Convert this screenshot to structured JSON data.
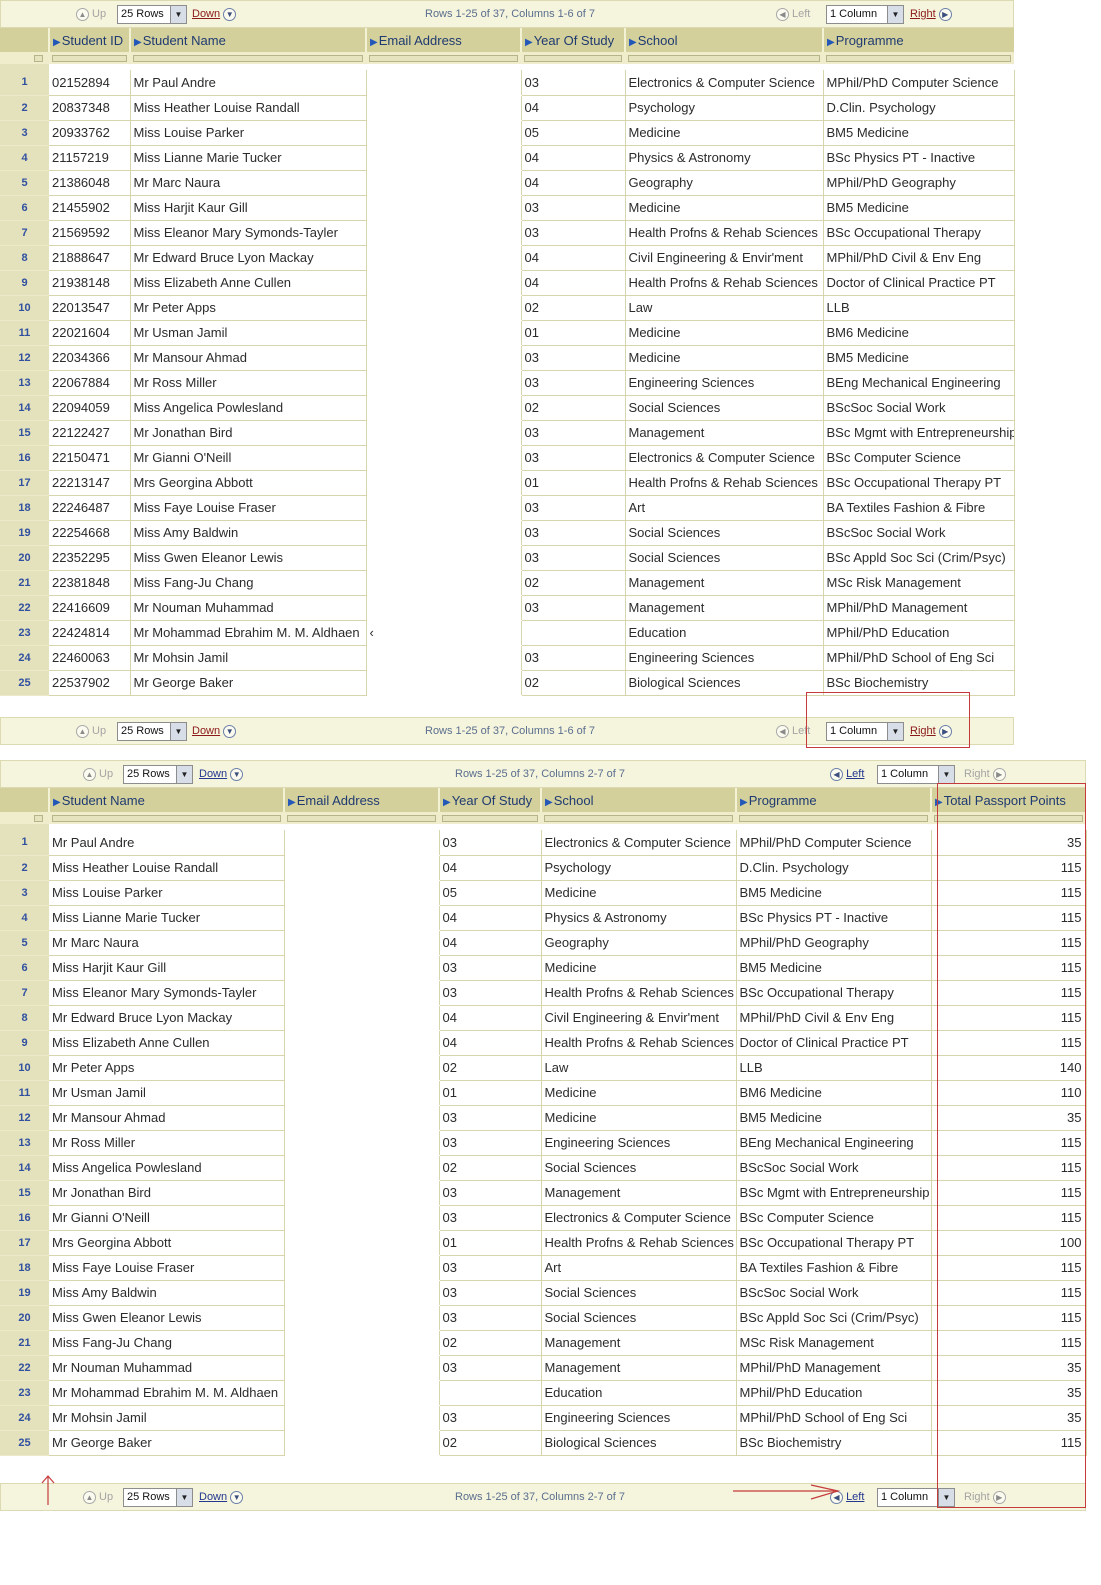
{
  "top": {
    "nav_top": {
      "up": "Up",
      "rows": "25 Rows",
      "down": "Down",
      "status": "Rows 1-25 of 37, Columns 1-6 of 7",
      "left": "Left",
      "cols": "1 Column",
      "right": "Right"
    },
    "nav_bottom": {
      "up": "Up",
      "rows": "25 Rows",
      "down": "Down",
      "status": "Rows 1-25 of 37, Columns 1-6 of 7",
      "left": "Left",
      "cols": "1 Column",
      "right": "Right"
    },
    "headers": [
      "Student ID",
      "Student Name",
      "Email Address",
      "Year Of Study",
      "School",
      "Programme"
    ],
    "rows": [
      {
        "n": "1",
        "id": "02152894",
        "name": "Mr Paul  Andre",
        "email": "",
        "year": "03",
        "school": "Electronics & Computer Science",
        "prog": "MPhil/PhD Computer Science"
      },
      {
        "n": "2",
        "id": "20837348",
        "name": "Miss Heather Louise Randall",
        "email": "",
        "year": "04",
        "school": "Psychology",
        "prog": "D.Clin. Psychology"
      },
      {
        "n": "3",
        "id": "20933762",
        "name": "Miss Louise  Parker",
        "email": "",
        "year": "05",
        "school": "Medicine",
        "prog": "BM5 Medicine"
      },
      {
        "n": "4",
        "id": "21157219",
        "name": "Miss Lianne Marie Tucker",
        "email": "",
        "year": "04",
        "school": "Physics & Astronomy",
        "prog": "BSc Physics PT - Inactive"
      },
      {
        "n": "5",
        "id": "21386048",
        "name": "Mr Marc  Naura",
        "email": "",
        "year": "04",
        "school": "Geography",
        "prog": "MPhil/PhD Geography"
      },
      {
        "n": "6",
        "id": "21455902",
        "name": "Miss Harjit Kaur Gill",
        "email": "",
        "year": "03",
        "school": "Medicine",
        "prog": "BM5 Medicine"
      },
      {
        "n": "7",
        "id": "21569592",
        "name": "Miss Eleanor Mary Symonds-Tayler",
        "email": "",
        "year": "03",
        "school": "Health Profns & Rehab Sciences",
        "prog": "BSc Occupational Therapy"
      },
      {
        "n": "8",
        "id": "21888647",
        "name": "Mr Edward Bruce Lyon Mackay",
        "email": "",
        "year": "04",
        "school": "Civil Engineering & Envir'ment",
        "prog": "MPhil/PhD Civil & Env Eng"
      },
      {
        "n": "9",
        "id": "21938148",
        "name": "Miss Elizabeth Anne Cullen",
        "email": "",
        "year": "04",
        "school": "Health Profns & Rehab Sciences",
        "prog": "Doctor of Clinical Practice PT"
      },
      {
        "n": "10",
        "id": "22013547",
        "name": "Mr Peter  Apps",
        "email": "",
        "year": "02",
        "school": "Law",
        "prog": "LLB"
      },
      {
        "n": "11",
        "id": "22021604",
        "name": "Mr Usman  Jamil",
        "email": "",
        "year": "01",
        "school": "Medicine",
        "prog": "BM6 Medicine"
      },
      {
        "n": "12",
        "id": "22034366",
        "name": "Mr Mansour  Ahmad",
        "email": "",
        "year": "03",
        "school": "Medicine",
        "prog": "BM5 Medicine"
      },
      {
        "n": "13",
        "id": "22067884",
        "name": "Mr Ross  Miller",
        "email": "",
        "year": "03",
        "school": "Engineering Sciences",
        "prog": "BEng Mechanical Engineering"
      },
      {
        "n": "14",
        "id": "22094059",
        "name": "Miss Angelica  Powlesland",
        "email": "",
        "year": "02",
        "school": "Social Sciences",
        "prog": "BScSoc Social Work"
      },
      {
        "n": "15",
        "id": "22122427",
        "name": "Mr Jonathan  Bird",
        "email": "",
        "year": "03",
        "school": "Management",
        "prog": "BSc Mgmt with Entrepreneurship"
      },
      {
        "n": "16",
        "id": "22150471",
        "name": "Mr Gianni  O'Neill",
        "email": "",
        "year": "03",
        "school": "Electronics & Computer Science",
        "prog": "BSc Computer Science"
      },
      {
        "n": "17",
        "id": "22213147",
        "name": "Mrs Georgina  Abbott",
        "email": "",
        "year": "01",
        "school": "Health Profns & Rehab Sciences",
        "prog": "BSc Occupational Therapy PT"
      },
      {
        "n": "18",
        "id": "22246487",
        "name": "Miss Faye Louise Fraser",
        "email": "",
        "year": "03",
        "school": "Art",
        "prog": "BA Textiles Fashion & Fibre"
      },
      {
        "n": "19",
        "id": "22254668",
        "name": "Miss Amy  Baldwin",
        "email": "",
        "year": "03",
        "school": "Social Sciences",
        "prog": "BScSoc Social Work"
      },
      {
        "n": "20",
        "id": "22352295",
        "name": "Miss Gwen Eleanor Lewis",
        "email": "",
        "year": "03",
        "school": "Social Sciences",
        "prog": "BSc Appld Soc Sci (Crim/Psyc)"
      },
      {
        "n": "21",
        "id": "22381848",
        "name": "Miss Fang-Ju  Chang",
        "email": "",
        "year": "02",
        "school": "Management",
        "prog": "MSc Risk Management"
      },
      {
        "n": "22",
        "id": "22416609",
        "name": "Mr Nouman  Muhammad",
        "email": "",
        "year": "03",
        "school": "Management",
        "prog": "MPhil/PhD Management"
      },
      {
        "n": "23",
        "id": "22424814",
        "name": "Mr Mohammad Ebrahim M. M. Aldhaen",
        "email": "‹",
        "year": "",
        "school": "Education",
        "prog": "MPhil/PhD Education"
      },
      {
        "n": "24",
        "id": "22460063",
        "name": "Mr Mohsin  Jamil",
        "email": "",
        "year": "03",
        "school": "Engineering Sciences",
        "prog": "MPhil/PhD School of Eng Sci"
      },
      {
        "n": "25",
        "id": "22537902",
        "name": "Mr George  Baker",
        "email": "",
        "year": "02",
        "school": "Biological Sciences",
        "prog": "BSc Biochemistry"
      }
    ]
  },
  "bottom": {
    "nav_top": {
      "up": "Up",
      "rows": "25 Rows",
      "down": "Down",
      "status": "Rows 1-25 of 37, Columns 2-7 of 7",
      "left": "Left",
      "cols": "1 Column",
      "right": "Right"
    },
    "nav_bottom": {
      "up": "Up",
      "rows": "25 Rows",
      "down": "Down",
      "status": "Rows 1-25 of 37, Columns 2-7 of 7",
      "left": "Left",
      "cols": "1 Column",
      "right": "Right"
    },
    "headers": [
      "Student Name",
      "Email Address",
      "Year Of Study",
      "School",
      "Programme",
      "Total Passport Points"
    ],
    "rows": [
      {
        "n": "1",
        "name": "Mr Paul  Andre",
        "email": "",
        "year": "03",
        "school": "Electronics & Computer Science",
        "prog": "MPhil/PhD Computer Science",
        "pts": "35"
      },
      {
        "n": "2",
        "name": "Miss Heather Louise Randall",
        "email": "",
        "year": "04",
        "school": "Psychology",
        "prog": "D.Clin. Psychology",
        "pts": "115"
      },
      {
        "n": "3",
        "name": "Miss Louise  Parker",
        "email": "",
        "year": "05",
        "school": "Medicine",
        "prog": "BM5 Medicine",
        "pts": "115"
      },
      {
        "n": "4",
        "name": "Miss Lianne Marie Tucker",
        "email": "",
        "year": "04",
        "school": "Physics & Astronomy",
        "prog": "BSc Physics PT - Inactive",
        "pts": "115"
      },
      {
        "n": "5",
        "name": "Mr Marc  Naura",
        "email": "",
        "year": "04",
        "school": "Geography",
        "prog": "MPhil/PhD Geography",
        "pts": "115"
      },
      {
        "n": "6",
        "name": "Miss Harjit Kaur Gill",
        "email": "",
        "year": "03",
        "school": "Medicine",
        "prog": "BM5 Medicine",
        "pts": "115"
      },
      {
        "n": "7",
        "name": "Miss Eleanor Mary Symonds-Tayler",
        "email": "",
        "year": "03",
        "school": "Health Profns & Rehab Sciences",
        "prog": "BSc Occupational Therapy",
        "pts": "115"
      },
      {
        "n": "8",
        "name": "Mr Edward Bruce Lyon Mackay",
        "email": "",
        "year": "04",
        "school": "Civil Engineering & Envir'ment",
        "prog": "MPhil/PhD Civil & Env Eng",
        "pts": "115"
      },
      {
        "n": "9",
        "name": "Miss Elizabeth Anne Cullen",
        "email": "",
        "year": "04",
        "school": "Health Profns & Rehab Sciences",
        "prog": "Doctor of Clinical Practice PT",
        "pts": "115"
      },
      {
        "n": "10",
        "name": "Mr Peter  Apps",
        "email": "",
        "year": "02",
        "school": "Law",
        "prog": "LLB",
        "pts": "140"
      },
      {
        "n": "11",
        "name": "Mr Usman  Jamil",
        "email": "",
        "year": "01",
        "school": "Medicine",
        "prog": "BM6 Medicine",
        "pts": "110"
      },
      {
        "n": "12",
        "name": "Mr Mansour  Ahmad",
        "email": "",
        "year": "03",
        "school": "Medicine",
        "prog": "BM5 Medicine",
        "pts": "35"
      },
      {
        "n": "13",
        "name": "Mr Ross  Miller",
        "email": "",
        "year": "03",
        "school": "Engineering Sciences",
        "prog": "BEng Mechanical Engineering",
        "pts": "115"
      },
      {
        "n": "14",
        "name": "Miss Angelica  Powlesland",
        "email": "",
        "year": "02",
        "school": "Social Sciences",
        "prog": "BScSoc Social Work",
        "pts": "115"
      },
      {
        "n": "15",
        "name": "Mr Jonathan  Bird",
        "email": "",
        "year": "03",
        "school": "Management",
        "prog": "BSc Mgmt with Entrepreneurship",
        "pts": "115"
      },
      {
        "n": "16",
        "name": "Mr Gianni  O'Neill",
        "email": "",
        "year": "03",
        "school": "Electronics & Computer Science",
        "prog": "BSc Computer Science",
        "pts": "115"
      },
      {
        "n": "17",
        "name": "Mrs Georgina  Abbott",
        "email": "",
        "year": "01",
        "school": "Health Profns & Rehab Sciences",
        "prog": "BSc Occupational Therapy PT",
        "pts": "100"
      },
      {
        "n": "18",
        "name": "Miss Faye Louise Fraser",
        "email": "",
        "year": "03",
        "school": "Art",
        "prog": "BA Textiles Fashion & Fibre",
        "pts": "115"
      },
      {
        "n": "19",
        "name": "Miss Amy  Baldwin",
        "email": "",
        "year": "03",
        "school": "Social Sciences",
        "prog": "BScSoc Social Work",
        "pts": "115"
      },
      {
        "n": "20",
        "name": "Miss Gwen Eleanor Lewis",
        "email": "",
        "year": "03",
        "school": "Social Sciences",
        "prog": "BSc Appld Soc Sci (Crim/Psyc)",
        "pts": "115"
      },
      {
        "n": "21",
        "name": "Miss Fang-Ju  Chang",
        "email": "",
        "year": "02",
        "school": "Management",
        "prog": "MSc Risk Management",
        "pts": "115"
      },
      {
        "n": "22",
        "name": "Mr Nouman  Muhammad",
        "email": "",
        "year": "03",
        "school": "Management",
        "prog": "MPhil/PhD Management",
        "pts": "35"
      },
      {
        "n": "23",
        "name": "Mr Mohammad Ebrahim M. M. Aldhaen",
        "email": "",
        "year": "",
        "school": "Education",
        "prog": "MPhil/PhD Education",
        "pts": "35"
      },
      {
        "n": "24",
        "name": "Mr Mohsin  Jamil",
        "email": "",
        "year": "03",
        "school": "Engineering Sciences",
        "prog": "MPhil/PhD School of Eng Sci",
        "pts": "35"
      },
      {
        "n": "25",
        "name": "Mr George  Baker",
        "email": "",
        "year": "02",
        "school": "Biological Sciences",
        "prog": "BSc Biochemistry",
        "pts": "115"
      }
    ]
  },
  "icons": {
    "up": "circle-up-icon",
    "down": "circle-down-icon",
    "left": "circle-left-icon",
    "right": "circle-right-icon",
    "sort": "sort-triangle-icon"
  },
  "colors": {
    "header_bg": "#d3d09c",
    "rownum_bg": "#e4e1bd",
    "nav_bg": "#f5f4dd",
    "annotation": "#c53b3b"
  }
}
